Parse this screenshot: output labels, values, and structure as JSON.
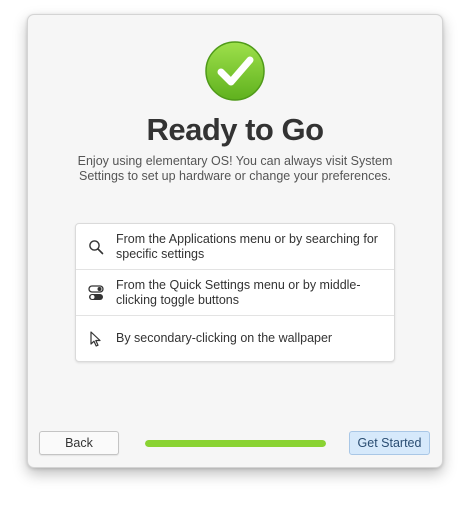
{
  "header": {
    "icon": "checkmark-badge-icon",
    "title": "Ready to Go",
    "description": "Enjoy using elementary OS! You can always visit System Settings to set up hardware or change your preferences."
  },
  "tips": [
    {
      "icon": "search-icon",
      "text": "From the Applications menu or by searching for specific settings"
    },
    {
      "icon": "toggle-icon",
      "text": "From the Quick Settings menu or by middle-clicking toggle buttons"
    },
    {
      "icon": "pointer-icon",
      "text": "By secondary-clicking on the wallpaper"
    }
  ],
  "footer": {
    "back_label": "Back",
    "start_label": "Get Started",
    "progress_fraction": 1.0
  },
  "colors": {
    "accent_green": "#8ad332",
    "suggested_button_bg": "#d6e9fb"
  }
}
